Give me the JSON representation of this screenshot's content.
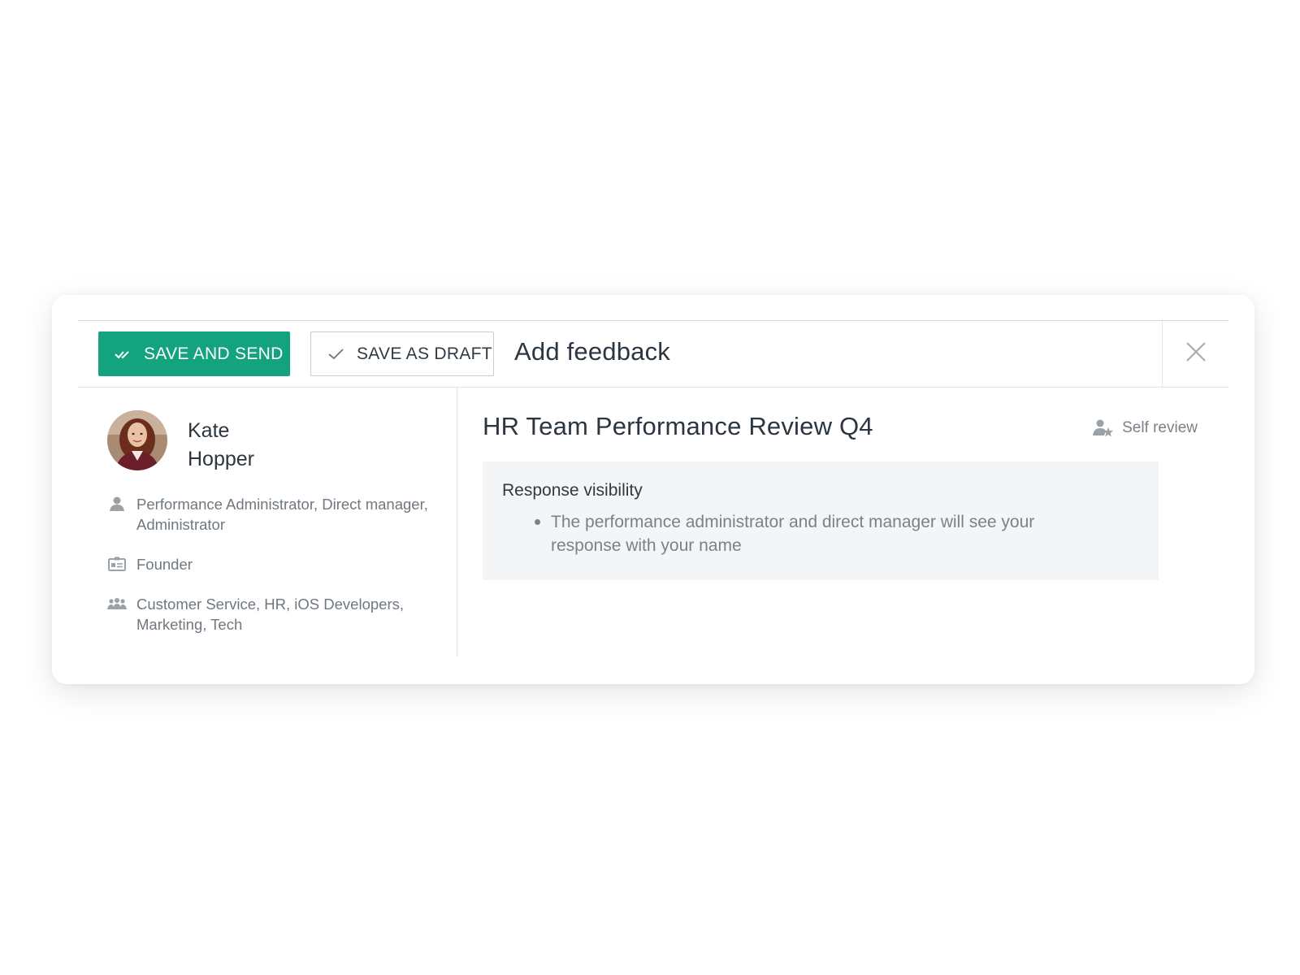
{
  "toolbar": {
    "save_and_send_label": "SAVE AND SEND",
    "save_as_draft_label": "SAVE AS DRAFT",
    "dialog_title": "Add feedback"
  },
  "profile": {
    "first_name": "Kate",
    "last_name": "Hopper",
    "roles": "Performance Administrator, Direct manager, Administrator",
    "job_title": "Founder",
    "teams": "Customer Service, HR, iOS Developers, Marketing, Tech"
  },
  "review": {
    "title": "HR Team Performance Review Q4",
    "type_label": "Self review",
    "visibility_heading": "Response visibility",
    "visibility_items": [
      "The performance administrator and direct manager will see your response with your name"
    ]
  },
  "colors": {
    "accent": "#14a37f",
    "text_dark": "#2c3640",
    "text_muted": "#7a8289",
    "panel_bg": "#f3f5f6"
  },
  "icons": {
    "save_and_send": "double-check-icon",
    "save_as_draft": "check-icon",
    "close": "close-icon",
    "roles": "user-icon",
    "job_title": "id-card-icon",
    "teams": "group-icon",
    "self_review": "user-star-icon"
  }
}
